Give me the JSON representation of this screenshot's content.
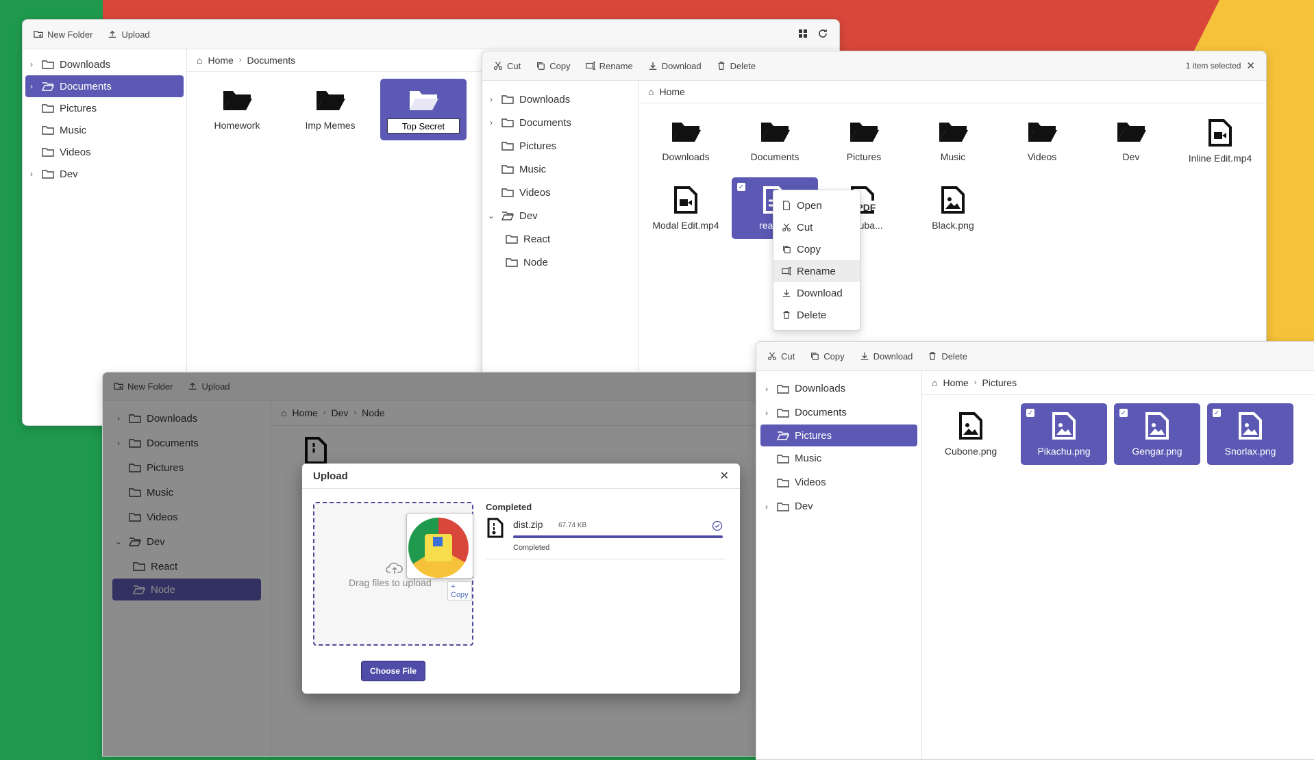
{
  "windows": {
    "docs": {
      "toolbar": {
        "new_folder": "New Folder",
        "upload": "Upload"
      },
      "sidebar": [
        "Downloads",
        "Documents",
        "Pictures",
        "Music",
        "Videos",
        "Dev"
      ],
      "breadcrumb": [
        "Home",
        "Documents"
      ],
      "items": [
        "Homework",
        "Imp Memes",
        "Top Secret"
      ],
      "rename_value": "Top Secret"
    },
    "home": {
      "toolbar": {
        "cut": "Cut",
        "copy": "Copy",
        "rename": "Rename",
        "download": "Download",
        "delete": "Delete",
        "selected": "1 item selected"
      },
      "sidebar": [
        "Downloads",
        "Documents",
        "Pictures",
        "Music",
        "Videos",
        "Dev",
        "React",
        "Node"
      ],
      "breadcrumb": [
        "Home"
      ],
      "items": [
        "Downloads",
        "Documents",
        "Pictures",
        "Music",
        "Videos",
        "Dev",
        "Inline Edit.mp4",
        "Modal Edit.mp4",
        "react-fil",
        "h Zuba...",
        "Black.png"
      ],
      "pdf_badge": "PDF",
      "context_menu": [
        "Open",
        "Cut",
        "Copy",
        "Rename",
        "Download",
        "Delete"
      ]
    },
    "node": {
      "toolbar": {
        "new_folder": "New Folder",
        "upload": "Upload"
      },
      "sidebar": [
        "Downloads",
        "Documents",
        "Pictures",
        "Music",
        "Videos",
        "Dev",
        "React",
        "Node"
      ],
      "breadcrumb": [
        "Home",
        "Dev",
        "Node"
      ]
    },
    "pictures": {
      "toolbar": {
        "cut": "Cut",
        "copy": "Copy",
        "download": "Download",
        "delete": "Delete"
      },
      "sidebar": [
        "Downloads",
        "Documents",
        "Pictures",
        "Music",
        "Videos",
        "Dev"
      ],
      "breadcrumb": [
        "Home",
        "Pictures"
      ],
      "items": [
        "Cubone.png",
        "Pikachu.png",
        "Gengar.png",
        "Snorlax.png"
      ]
    }
  },
  "upload_modal": {
    "title": "Upload",
    "drop_text": "Drag files to upload",
    "copy_hint": "+ Copy",
    "choose_file": "Choose File",
    "section": "Completed",
    "file": {
      "name": "dist.zip",
      "size": "67.74 KB",
      "status": "Completed",
      "progress": 100
    }
  },
  "colors": {
    "accent": "#5b59b3",
    "bg_red": "#d9473b",
    "bg_green": "#1f9a4d",
    "bg_yellow": "#f6c23a"
  }
}
